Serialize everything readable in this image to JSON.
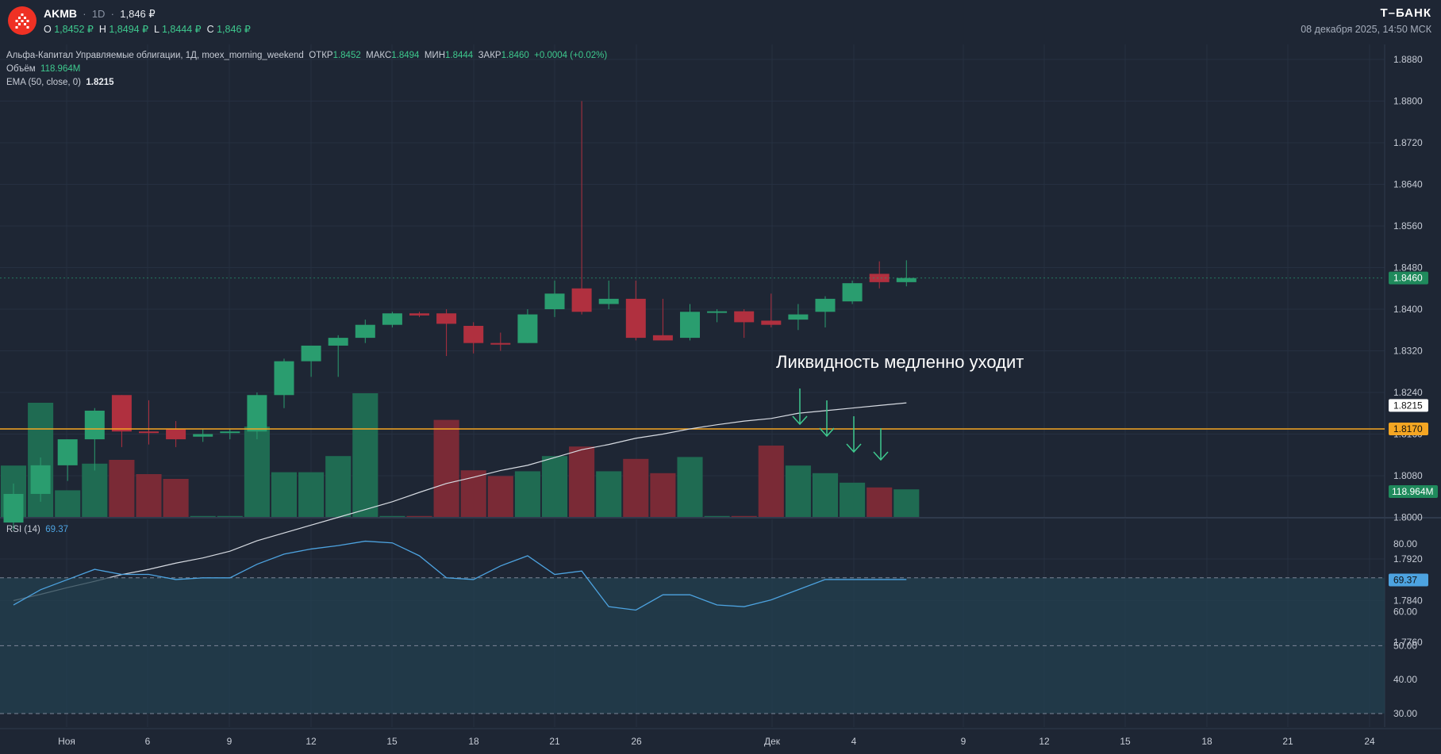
{
  "header": {
    "symbol": "AKMB",
    "interval": "1D",
    "price": "1,846 ₽",
    "ohlc": {
      "o_label": "O",
      "o_value": "1,8452 ₽",
      "h_label": "H",
      "h_value": "1,8494 ₽",
      "l_label": "L",
      "l_value": "1,8444 ₽",
      "c_label": "C",
      "c_value": "1,846 ₽"
    },
    "brand": "Т–БАНК",
    "date": "08 декабря 2025, 14:50 МСК"
  },
  "legend": {
    "main": {
      "text": "Альфа-Капитал Управляемые облигации, 1Д, moex_morning_weekend",
      "open_label": "ОТКР",
      "open": "1.8452",
      "high_label": "МАКС",
      "high": "1.8494",
      "low_label": "МИН",
      "low": "1.8444",
      "close_label": "ЗАКР",
      "close": "1.8460",
      "change": "+0.0004 (+0.02%)"
    },
    "volume": {
      "label": "Объём",
      "value": "118.964M"
    },
    "ema": {
      "label": "EMA (50, close, 0)",
      "value": "1.8215"
    },
    "rsi": {
      "label": "RSI (14)",
      "value": "69.37"
    }
  },
  "annotation": "Ликвидность медленно уходит",
  "colors": {
    "background": "#1e2634",
    "up": "#2a9d6f",
    "down": "#b0303f",
    "volume_up": "#1f6b52",
    "volume_down": "#7a2a36",
    "ema": "#d7dbe2",
    "level": "#f5a623",
    "rsi_line": "#4da3e0",
    "rsi_band": "#23404f",
    "arrow": "#3ec98e"
  },
  "chart_data": [
    {
      "type": "candlestick",
      "title": "Альфа-Капитал Управляемые облигации, 1Д, moex_morning_weekend",
      "x_ticks": [
        "Ноя",
        "6",
        "9",
        "12",
        "15",
        "18",
        "21",
        "26",
        "Дек",
        "4",
        "9",
        "12",
        "15",
        "18",
        "21",
        "24"
      ],
      "y_ticks": [
        "1.8880",
        "1.8800",
        "1.8720",
        "1.8640",
        "1.8560",
        "1.8480",
        "1.8400",
        "1.8320",
        "1.8240",
        "1.8160",
        "1.8080",
        "1.8000",
        "1.7920",
        "1.7840",
        "1.7760"
      ],
      "ylim": [
        1.7745,
        1.8895
      ],
      "candles": [
        {
          "o": 1.799,
          "h": 1.8065,
          "l": 1.7975,
          "c": 1.8045
        },
        {
          "o": 1.8045,
          "h": 1.8115,
          "l": 1.803,
          "c": 1.81
        },
        {
          "o": 1.81,
          "h": 1.815,
          "l": 1.807,
          "c": 1.815
        },
        {
          "o": 1.815,
          "h": 1.821,
          "l": 1.809,
          "c": 1.8205
        },
        {
          "o": 1.8235,
          "h": 1.8235,
          "l": 1.8135,
          "c": 1.8165
        },
        {
          "o": 1.8165,
          "h": 1.8225,
          "l": 1.814,
          "c": 1.8162
        },
        {
          "o": 1.817,
          "h": 1.8185,
          "l": 1.8135,
          "c": 1.815
        },
        {
          "o": 1.8155,
          "h": 1.817,
          "l": 1.8145,
          "c": 1.816
        },
        {
          "o": 1.8162,
          "h": 1.817,
          "l": 1.815,
          "c": 1.8165
        },
        {
          "o": 1.8165,
          "h": 1.824,
          "l": 1.815,
          "c": 1.8235
        },
        {
          "o": 1.8235,
          "h": 1.8305,
          "l": 1.821,
          "c": 1.83
        },
        {
          "o": 1.83,
          "h": 1.833,
          "l": 1.827,
          "c": 1.833
        },
        {
          "o": 1.833,
          "h": 1.835,
          "l": 1.827,
          "c": 1.8345
        },
        {
          "o": 1.8345,
          "h": 1.838,
          "l": 1.8335,
          "c": 1.837
        },
        {
          "o": 1.837,
          "h": 1.8395,
          "l": 1.8365,
          "c": 1.8392
        },
        {
          "o": 1.8392,
          "h": 1.8395,
          "l": 1.8385,
          "c": 1.8388
        },
        {
          "o": 1.8392,
          "h": 1.84,
          "l": 1.831,
          "c": 1.8372
        },
        {
          "o": 1.8368,
          "h": 1.8375,
          "l": 1.8315,
          "c": 1.8335
        },
        {
          "o": 1.8335,
          "h": 1.8355,
          "l": 1.832,
          "c": 1.8333
        },
        {
          "o": 1.8335,
          "h": 1.84,
          "l": 1.8335,
          "c": 1.839
        },
        {
          "o": 1.84,
          "h": 1.8455,
          "l": 1.8385,
          "c": 1.843
        },
        {
          "o": 1.844,
          "h": 1.88,
          "l": 1.839,
          "c": 1.8395
        },
        {
          "o": 1.841,
          "h": 1.8455,
          "l": 1.84,
          "c": 1.842
        },
        {
          "o": 1.842,
          "h": 1.8455,
          "l": 1.834,
          "c": 1.8345
        },
        {
          "o": 1.835,
          "h": 1.842,
          "l": 1.834,
          "c": 1.834
        },
        {
          "o": 1.8345,
          "h": 1.841,
          "l": 1.834,
          "c": 1.8395
        },
        {
          "o": 1.8393,
          "h": 1.84,
          "l": 1.8375,
          "c": 1.8396
        },
        {
          "o": 1.8396,
          "h": 1.84,
          "l": 1.8345,
          "c": 1.8375
        },
        {
          "o": 1.8378,
          "h": 1.843,
          "l": 1.8365,
          "c": 1.837
        },
        {
          "o": 1.838,
          "h": 1.841,
          "l": 1.836,
          "c": 1.839
        },
        {
          "o": 1.8395,
          "h": 1.8425,
          "l": 1.8365,
          "c": 1.842
        },
        {
          "o": 1.8415,
          "h": 1.8455,
          "l": 1.841,
          "c": 1.845
        },
        {
          "o": 1.8468,
          "h": 1.8492,
          "l": 1.844,
          "c": 1.8452
        },
        {
          "o": 1.8452,
          "h": 1.8494,
          "l": 1.8444,
          "c": 1.846
        }
      ],
      "ema": [
        1.784,
        1.7852,
        1.7865,
        1.7877,
        1.789,
        1.79,
        1.7912,
        1.7922,
        1.7935,
        1.7955,
        1.797,
        1.7985,
        1.8,
        1.8015,
        1.803,
        1.8048,
        1.8065,
        1.8077,
        1.809,
        1.81,
        1.8115,
        1.813,
        1.814,
        1.8152,
        1.816,
        1.817,
        1.8178,
        1.8185,
        1.819,
        1.82,
        1.8205,
        1.821,
        1.8215,
        1.822
      ],
      "level": 1.817,
      "price_labels": [
        "1.8460",
        "1.8215",
        "1.8170"
      ],
      "volume_label": "118.964M"
    },
    {
      "type": "bar",
      "title": "Объём",
      "values": [
        0.54,
        1.2,
        0.28,
        0.56,
        0.6,
        0.45,
        0.4,
        0.01,
        0.01,
        0.95,
        0.47,
        0.47,
        0.64,
        1.3,
        0.01,
        0.01,
        1.02,
        0.49,
        0.43,
        0.48,
        0.64,
        0.74,
        0.48,
        0.61,
        0.46,
        0.63,
        0.01,
        0.01,
        0.75,
        0.54,
        0.46,
        0.36,
        0.31,
        0.29
      ],
      "value_unit": "relative to pane height"
    },
    {
      "type": "line",
      "title": "RSI (14)",
      "y_ticks": [
        "80.00",
        "70.00",
        "60.00",
        "50.00",
        "40.00",
        "30.00"
      ],
      "ylim": [
        26,
        83
      ],
      "values": [
        62,
        66.5,
        69.5,
        72.5,
        71,
        71,
        69.5,
        70,
        70,
        74,
        77,
        78.5,
        79.5,
        80.8,
        80.3,
        76.5,
        70,
        69.5,
        73.5,
        76.5,
        71,
        72,
        61.5,
        60.5,
        65,
        65,
        62,
        61.5,
        63.5,
        66.5,
        69.5,
        69.5,
        69.5,
        69.5
      ],
      "band": [
        30,
        70
      ],
      "current": "69.37"
    }
  ]
}
